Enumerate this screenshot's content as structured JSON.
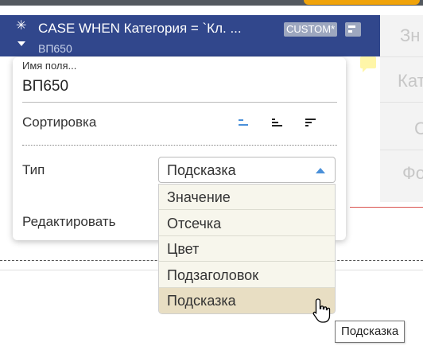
{
  "column_header": {
    "formula": "CASE WHEN Категория = `Кл. ...",
    "alias": "ВП650",
    "badge": "CUSTOM*"
  },
  "right_column": [
    "Зн",
    "Кат",
    "С",
    "Фо"
  ],
  "field_popup": {
    "name_label": "Имя поля...",
    "name_value": "ВП650",
    "sort_label": "Сортировка",
    "type_label": "Тип",
    "edit_label": "Редактировать"
  },
  "type_select": {
    "selected": "Подсказка",
    "options": [
      "Значение",
      "Отсечка",
      "Цвет",
      "Подзаголовок",
      "Подсказка"
    ]
  },
  "tooltip": "Подсказка",
  "colors": {
    "header_bg": "#31478c",
    "accent_blue": "#4a90d9",
    "dropdown_bg": "#f7f6ec",
    "selected_option_bg": "#e8dec3",
    "brand_orange": "#f0a30a"
  }
}
